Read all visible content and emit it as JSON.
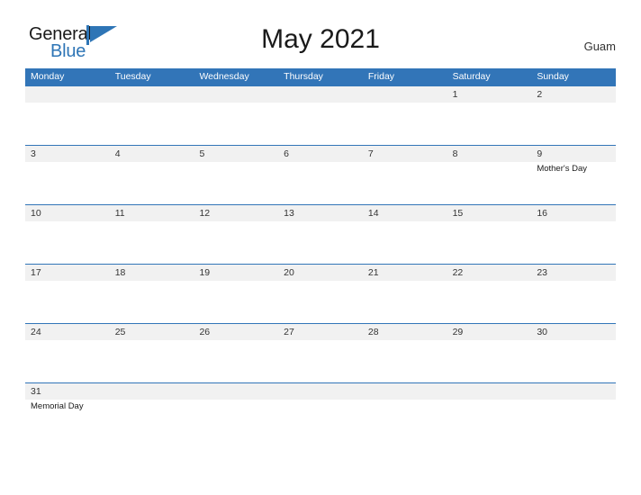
{
  "brand": {
    "word_one": "General",
    "word_two": "Blue",
    "flag_icon": "blue-flag-triangle",
    "color_dark": "#1a1a1a",
    "color_blue": "#2e75b6"
  },
  "header": {
    "title": "May 2021",
    "region": "Guam"
  },
  "theme": {
    "header_blue": "#3275b8",
    "date_band_gray": "#f1f1f1",
    "row_divider": "#3275b8",
    "text_dark": "#333333",
    "page_background": "#ffffff"
  },
  "calendar": {
    "weekdays": [
      "Monday",
      "Tuesday",
      "Wednesday",
      "Thursday",
      "Friday",
      "Saturday",
      "Sunday"
    ],
    "weeks": [
      [
        {
          "date": "",
          "event": ""
        },
        {
          "date": "",
          "event": ""
        },
        {
          "date": "",
          "event": ""
        },
        {
          "date": "",
          "event": ""
        },
        {
          "date": "",
          "event": ""
        },
        {
          "date": "1",
          "event": ""
        },
        {
          "date": "2",
          "event": ""
        }
      ],
      [
        {
          "date": "3",
          "event": ""
        },
        {
          "date": "4",
          "event": ""
        },
        {
          "date": "5",
          "event": ""
        },
        {
          "date": "6",
          "event": ""
        },
        {
          "date": "7",
          "event": ""
        },
        {
          "date": "8",
          "event": ""
        },
        {
          "date": "9",
          "event": "Mother's Day"
        }
      ],
      [
        {
          "date": "10",
          "event": ""
        },
        {
          "date": "11",
          "event": ""
        },
        {
          "date": "12",
          "event": ""
        },
        {
          "date": "13",
          "event": ""
        },
        {
          "date": "14",
          "event": ""
        },
        {
          "date": "15",
          "event": ""
        },
        {
          "date": "16",
          "event": ""
        }
      ],
      [
        {
          "date": "17",
          "event": ""
        },
        {
          "date": "18",
          "event": ""
        },
        {
          "date": "19",
          "event": ""
        },
        {
          "date": "20",
          "event": ""
        },
        {
          "date": "21",
          "event": ""
        },
        {
          "date": "22",
          "event": ""
        },
        {
          "date": "23",
          "event": ""
        }
      ],
      [
        {
          "date": "24",
          "event": ""
        },
        {
          "date": "25",
          "event": ""
        },
        {
          "date": "26",
          "event": ""
        },
        {
          "date": "27",
          "event": ""
        },
        {
          "date": "28",
          "event": ""
        },
        {
          "date": "29",
          "event": ""
        },
        {
          "date": "30",
          "event": ""
        }
      ],
      [
        {
          "date": "31",
          "event": "Memorial Day"
        },
        {
          "date": "",
          "event": ""
        },
        {
          "date": "",
          "event": ""
        },
        {
          "date": "",
          "event": ""
        },
        {
          "date": "",
          "event": ""
        },
        {
          "date": "",
          "event": ""
        },
        {
          "date": "",
          "event": ""
        }
      ]
    ]
  }
}
